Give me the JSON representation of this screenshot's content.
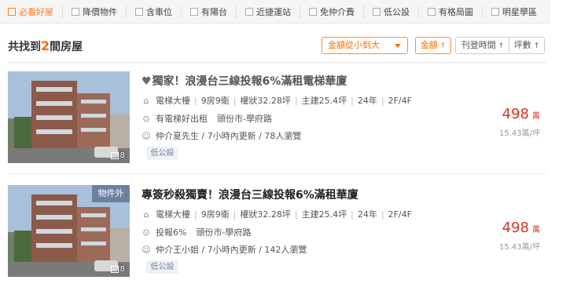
{
  "filters": [
    {
      "label": "必看好屋",
      "active": true
    },
    {
      "label": "降價物件",
      "active": false
    },
    {
      "label": "含車位",
      "active": false
    },
    {
      "label": "有陽台",
      "active": false
    },
    {
      "label": "近捷運站",
      "active": false
    },
    {
      "label": "免仲介費",
      "active": false
    },
    {
      "label": "低公設",
      "active": false
    },
    {
      "label": "有格局圖",
      "active": false
    },
    {
      "label": "明星學區",
      "active": false
    }
  ],
  "results": {
    "prefix": "共找到",
    "count": "2",
    "suffix": "間房屋"
  },
  "sort": {
    "selected": "金額從小到大",
    "buttons": [
      {
        "label": "金額",
        "arrow": "↑",
        "active": true
      },
      {
        "label": "刊登時間",
        "arrow": "↑",
        "active": false
      },
      {
        "label": "坪數",
        "arrow": "↑",
        "active": false
      }
    ]
  },
  "listings": [
    {
      "title": "獨家！浪漫台三線投報6%滿租電梯華廈",
      "has_heart": true,
      "out_badge": "",
      "photo_count": "8",
      "type": "電梯大樓",
      "layout": "9房9衛",
      "ownership_area": "權狀32.28坪",
      "main_area": "主建25.4坪",
      "age": "24年",
      "floor": "2F/4F",
      "highlight": "有電梯好出租",
      "location": "頭份市-學府路",
      "agent_info": "仲介夏先生 / 7小時內更新 / 78人瀏覽",
      "tag": "低公設",
      "price": "498",
      "price_unit": "萬",
      "unit_price": "15.43萬/坪"
    },
    {
      "title": "專簽秒殺獨賣！浪漫台三線投報6%滿租華廈",
      "has_heart": false,
      "out_badge": "物件外",
      "photo_count": "8",
      "type": "電梯大樓",
      "layout": "9房9衛",
      "ownership_area": "權狀32.28坪",
      "main_area": "主建25.4坪",
      "age": "24年",
      "floor": "2F/4F",
      "highlight": "投報6%",
      "location": "頭份市-學府路",
      "agent_info": "仲介王小姐 / 7小時內更新 / 142人瀏覽",
      "tag": "低公設",
      "price": "498",
      "price_unit": "萬",
      "unit_price": "15.43萬/坪"
    }
  ]
}
